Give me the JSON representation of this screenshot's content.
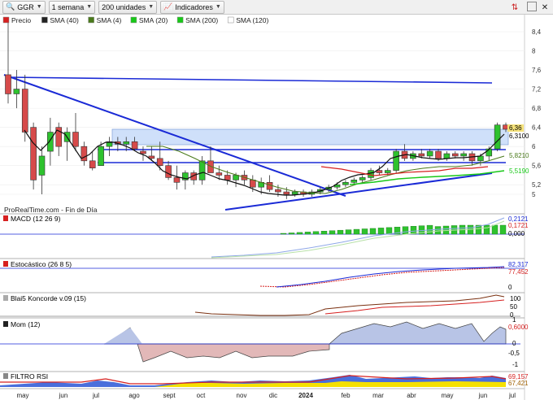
{
  "toolbar": {
    "ticker": "GGR",
    "period": "1 semana",
    "units": "200 unidades",
    "indicators": "Indicadores"
  },
  "main_panel": {
    "legend": [
      "Precio",
      "SMA (40)",
      "SMA (4)",
      "SMA (20)",
      "SMA (200)",
      "SMA (120)"
    ],
    "legend_colors": [
      "#d62020",
      "#222222",
      "#4a7a1a",
      "#18c818",
      "#bbbbbb",
      "#d62020"
    ],
    "source": "ProRealTime.com - Fin de Día",
    "y_ticks": [
      "8,4",
      "8",
      "7,6",
      "7,2",
      "6,8",
      "6,4",
      "6",
      "5,6",
      "5,2",
      "5"
    ],
    "tags": [
      "6,36",
      "6,3100",
      "5,8210",
      "5,5190"
    ]
  },
  "macd": {
    "label": "MACD (12 26 9)",
    "y_ticks": [
      "0,2121",
      "0,1721",
      "0,000"
    ]
  },
  "stoch": {
    "label": "Estocástico (26 8 5)",
    "y_ticks": [
      "82,317",
      "77,452",
      "0"
    ]
  },
  "blai5": {
    "label": "Blai5 Koncorde v.09 (15)",
    "y_ticks": [
      "100",
      "50",
      "0"
    ]
  },
  "mom": {
    "label": "Mom (12)",
    "y_ticks": [
      "1",
      "0,6000",
      "0",
      "-0,5",
      "-1"
    ]
  },
  "rsi": {
    "label": "FILTRO RSI",
    "y_ticks": [
      "69,157",
      "67,421"
    ]
  },
  "x_axis": [
    "may",
    "jun",
    "jul",
    "ago",
    "sept",
    "oct",
    "nov",
    "dic",
    "2024",
    "feb",
    "mar",
    "abr",
    "may",
    "jun",
    "jul"
  ],
  "colors": {
    "bull": "#2ec22e",
    "bear": "#d64a4a",
    "trendline": "#1a2ad6",
    "box": "#cfe0fa"
  },
  "chart_data": {
    "type": "candlestick",
    "series": [
      {
        "name": "Precio",
        "ohlc": [
          [
            7.5,
            8.6,
            6.9,
            7.1
          ],
          [
            7.1,
            7.6,
            6.8,
            7.2
          ],
          [
            7.2,
            7.5,
            6.1,
            6.3
          ],
          [
            6.4,
            6.5,
            5.1,
            5.3
          ],
          [
            5.4,
            6.0,
            5.0,
            5.8
          ],
          [
            5.9,
            6.6,
            5.6,
            6.3
          ],
          [
            6.4,
            6.5,
            5.8,
            6.0
          ],
          [
            6.1,
            6.4,
            5.7,
            6.3
          ],
          [
            6.3,
            6.7,
            5.9,
            6.0
          ],
          [
            6.0,
            6.1,
            5.6,
            5.7
          ],
          [
            5.7,
            5.9,
            5.5,
            5.55
          ],
          [
            5.6,
            6.1,
            5.6,
            6.0
          ],
          [
            6.0,
            6.2,
            5.8,
            6.1
          ],
          [
            6.1,
            6.2,
            5.9,
            6.05
          ],
          [
            6.05,
            6.2,
            5.9,
            6.1
          ],
          [
            6.1,
            6.2,
            5.9,
            5.95
          ],
          [
            5.9,
            6.0,
            5.7,
            5.85
          ],
          [
            5.8,
            6.0,
            5.7,
            5.75
          ],
          [
            5.75,
            6.1,
            5.5,
            5.6
          ],
          [
            5.6,
            5.7,
            5.3,
            5.35
          ],
          [
            5.35,
            5.6,
            5.1,
            5.25
          ],
          [
            5.3,
            5.5,
            5.1,
            5.45
          ],
          [
            5.45,
            5.5,
            5.2,
            5.3
          ],
          [
            5.3,
            5.8,
            5.2,
            5.7
          ],
          [
            5.7,
            6.0,
            5.5,
            5.45
          ],
          [
            5.45,
            5.6,
            5.3,
            5.4
          ],
          [
            5.4,
            5.5,
            5.2,
            5.3
          ],
          [
            5.3,
            5.45,
            5.15,
            5.4
          ],
          [
            5.4,
            5.5,
            5.2,
            5.3
          ],
          [
            5.3,
            5.4,
            5.05,
            5.15
          ],
          [
            5.15,
            5.35,
            5.0,
            5.25
          ],
          [
            5.25,
            5.4,
            5.05,
            5.1
          ],
          [
            5.1,
            5.2,
            4.95,
            5.05
          ],
          [
            5.05,
            5.15,
            4.9,
            5.0
          ],
          [
            5.0,
            5.1,
            4.95,
            5.05
          ],
          [
            5.05,
            5.1,
            4.95,
            5.0
          ],
          [
            5.0,
            5.1,
            4.95,
            5.05
          ],
          [
            5.05,
            5.15,
            5.0,
            5.1
          ],
          [
            5.1,
            5.2,
            5.05,
            5.15
          ],
          [
            5.15,
            5.25,
            5.1,
            5.2
          ],
          [
            5.2,
            5.3,
            5.15,
            5.25
          ],
          [
            5.25,
            5.35,
            5.2,
            5.3
          ],
          [
            5.3,
            5.4,
            5.25,
            5.35
          ],
          [
            5.35,
            5.55,
            5.3,
            5.5
          ],
          [
            5.5,
            5.6,
            5.4,
            5.45
          ],
          [
            5.45,
            5.55,
            5.4,
            5.5
          ],
          [
            5.5,
            5.95,
            5.45,
            5.9
          ],
          [
            5.9,
            6.05,
            5.7,
            5.75
          ],
          [
            5.75,
            5.9,
            5.7,
            5.85
          ],
          [
            5.85,
            5.95,
            5.75,
            5.8
          ],
          [
            5.8,
            5.95,
            5.75,
            5.9
          ],
          [
            5.9,
            5.95,
            5.7,
            5.75
          ],
          [
            5.75,
            5.9,
            5.7,
            5.85
          ],
          [
            5.85,
            5.9,
            5.75,
            5.8
          ],
          [
            5.8,
            5.9,
            5.7,
            5.85
          ],
          [
            5.85,
            5.9,
            5.6,
            5.7
          ],
          [
            5.7,
            5.85,
            5.6,
            5.8
          ],
          [
            5.8,
            6.0,
            5.7,
            5.95
          ],
          [
            5.95,
            6.5,
            5.9,
            6.45
          ],
          [
            6.45,
            6.5,
            6.3,
            6.36
          ]
        ]
      }
    ]
  }
}
